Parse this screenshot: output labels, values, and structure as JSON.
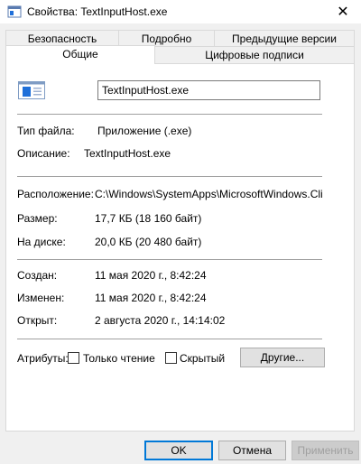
{
  "window": {
    "title": "Свойства: TextInputHost.exe",
    "close": "✕"
  },
  "tabs": {
    "security": "Безопасность",
    "details": "Подробно",
    "previous_versions": "Предыдущие версии",
    "general": "Общие",
    "digital_signatures": "Цифровые подписи"
  },
  "general": {
    "file_name": "TextInputHost.exe",
    "type_label": "Тип файла:",
    "type_value": "Приложение (.exe)",
    "description_label": "Описание:",
    "description_value": "TextInputHost.exe",
    "location_label": "Расположение:",
    "location_value": "C:\\Windows\\SystemApps\\MicrosoftWindows.Client.C",
    "size_label": "Размер:",
    "size_value": "17,7 КБ (18 160 байт)",
    "disk_label": "На диске:",
    "disk_value": "20,0 КБ (20 480 байт)",
    "created_label": "Создан:",
    "created_value": "11 мая 2020 г., 8:42:24",
    "modified_label": "Изменен:",
    "modified_value": "11 мая 2020 г., 8:42:24",
    "opened_label": "Открыт:",
    "opened_value": "2 августа 2020 г., 14:14:02",
    "attributes_label": "Атрибуты:",
    "readonly_label": "Только чтение",
    "hidden_label": "Скрытый",
    "other_button": "Другие..."
  },
  "footer": {
    "ok": "OK",
    "cancel": "Отмена",
    "apply": "Применить"
  },
  "colors": {
    "accent": "#0078d7",
    "icon_blue": "#1e6fd9"
  }
}
